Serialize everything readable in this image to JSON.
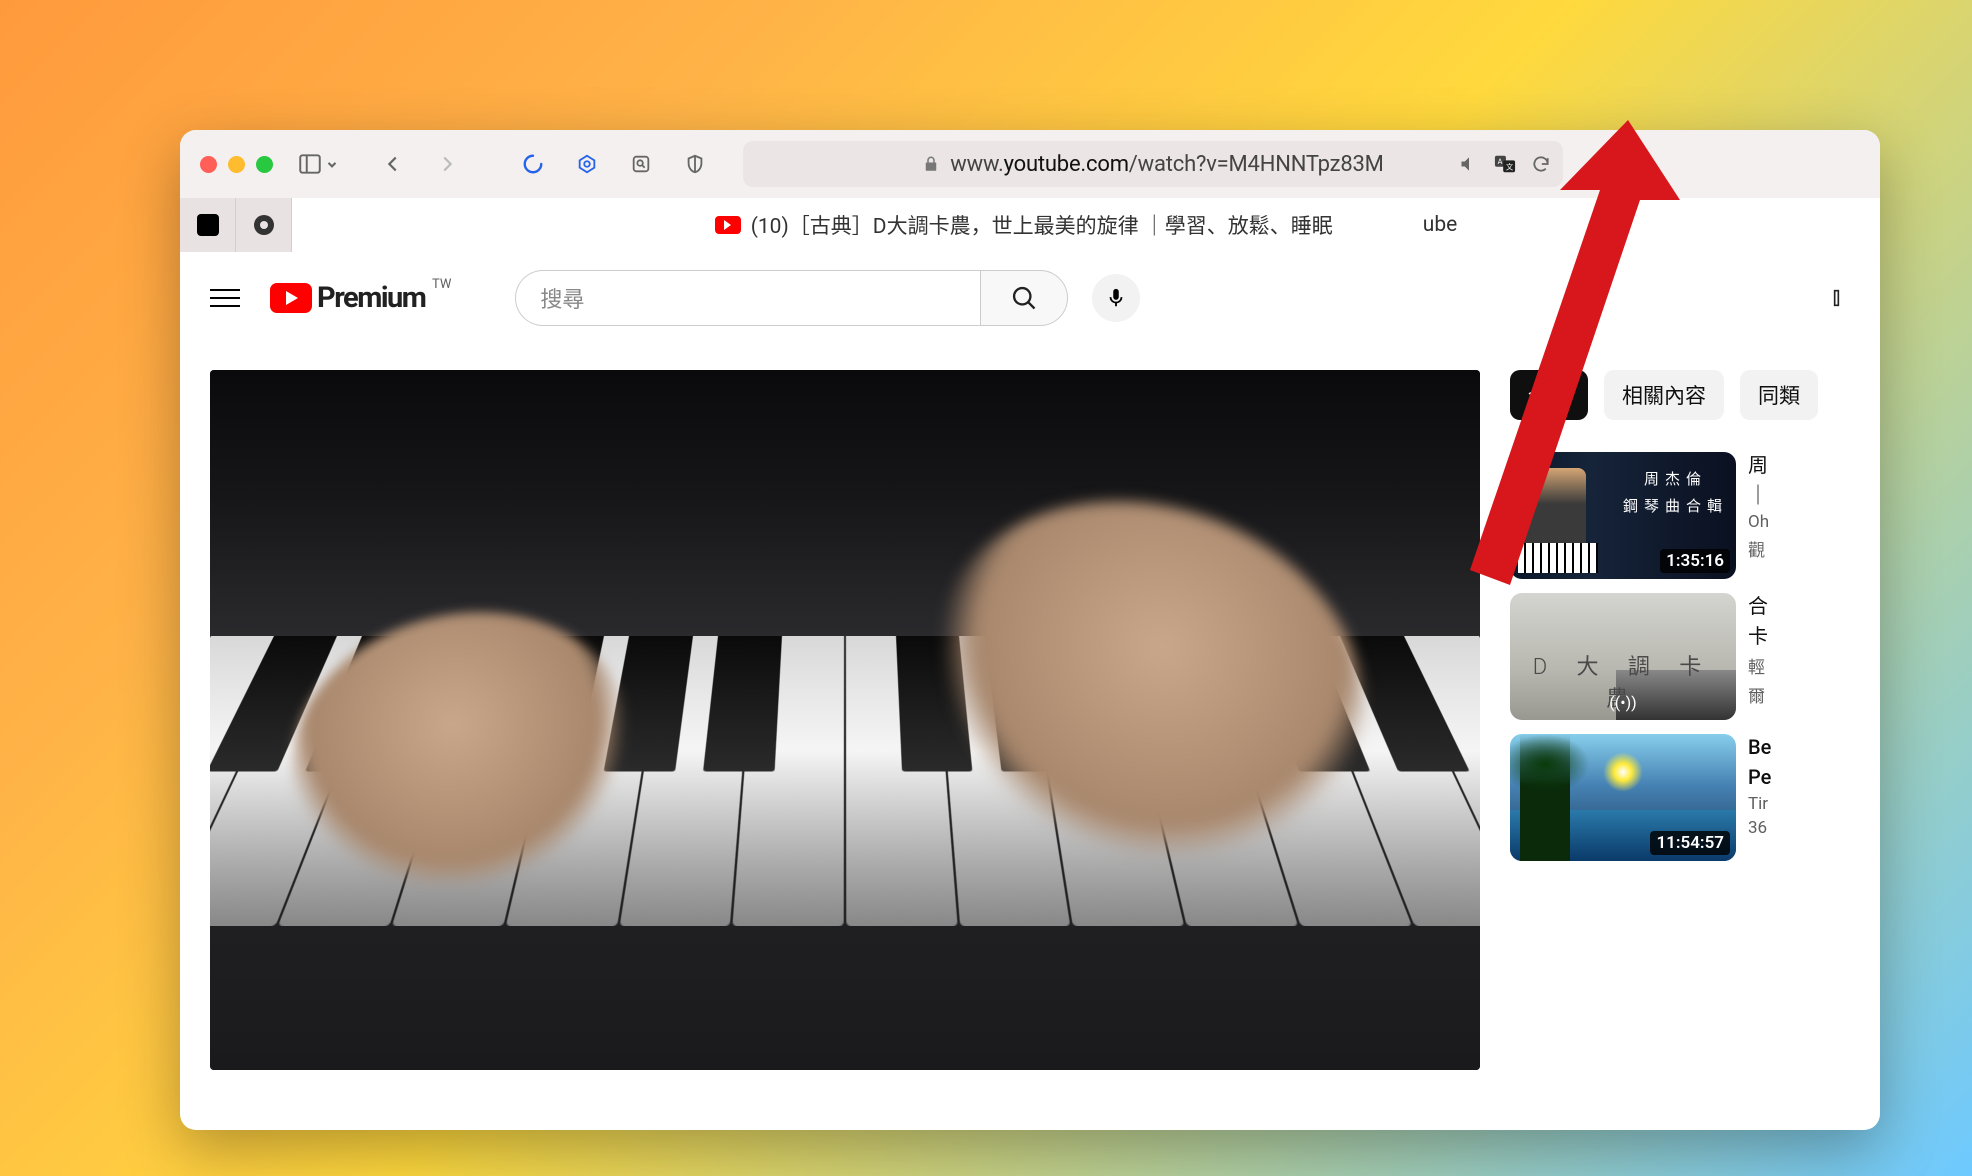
{
  "browser": {
    "url_prefix": "www.",
    "url_host": "youtube.com",
    "url_path": "/watch?v=M4HNNTpz83M"
  },
  "tab": {
    "title": "(10)［古典］D大調卡農，世上最美的旋律 ｜學習、放鬆、睡眠",
    "title_suffix": "ube"
  },
  "youtube": {
    "logo_text": "Premium",
    "logo_region": "TW",
    "search_placeholder": "搜尋",
    "chips": {
      "all": "全部",
      "related": "相關內容",
      "similar": "同類"
    }
  },
  "recommendations": [
    {
      "title_line1": "周",
      "title_line2": "｜",
      "sub1": "Oh",
      "sub2": "觀",
      "duration": "1:35:16",
      "thumb_text1": "周杰倫",
      "thumb_text2": "鋼琴曲合輯"
    },
    {
      "title_line1": "合",
      "title_line2": "卡",
      "sub1": "輕",
      "sub2": "爾",
      "live_indicator": "((•))",
      "thumb_text": "D 大 調 卡 農"
    },
    {
      "title_line1": "Be",
      "title_line2": "Pe",
      "sub1": "Tir",
      "sub2": "36",
      "duration": "11:54:57"
    }
  ]
}
